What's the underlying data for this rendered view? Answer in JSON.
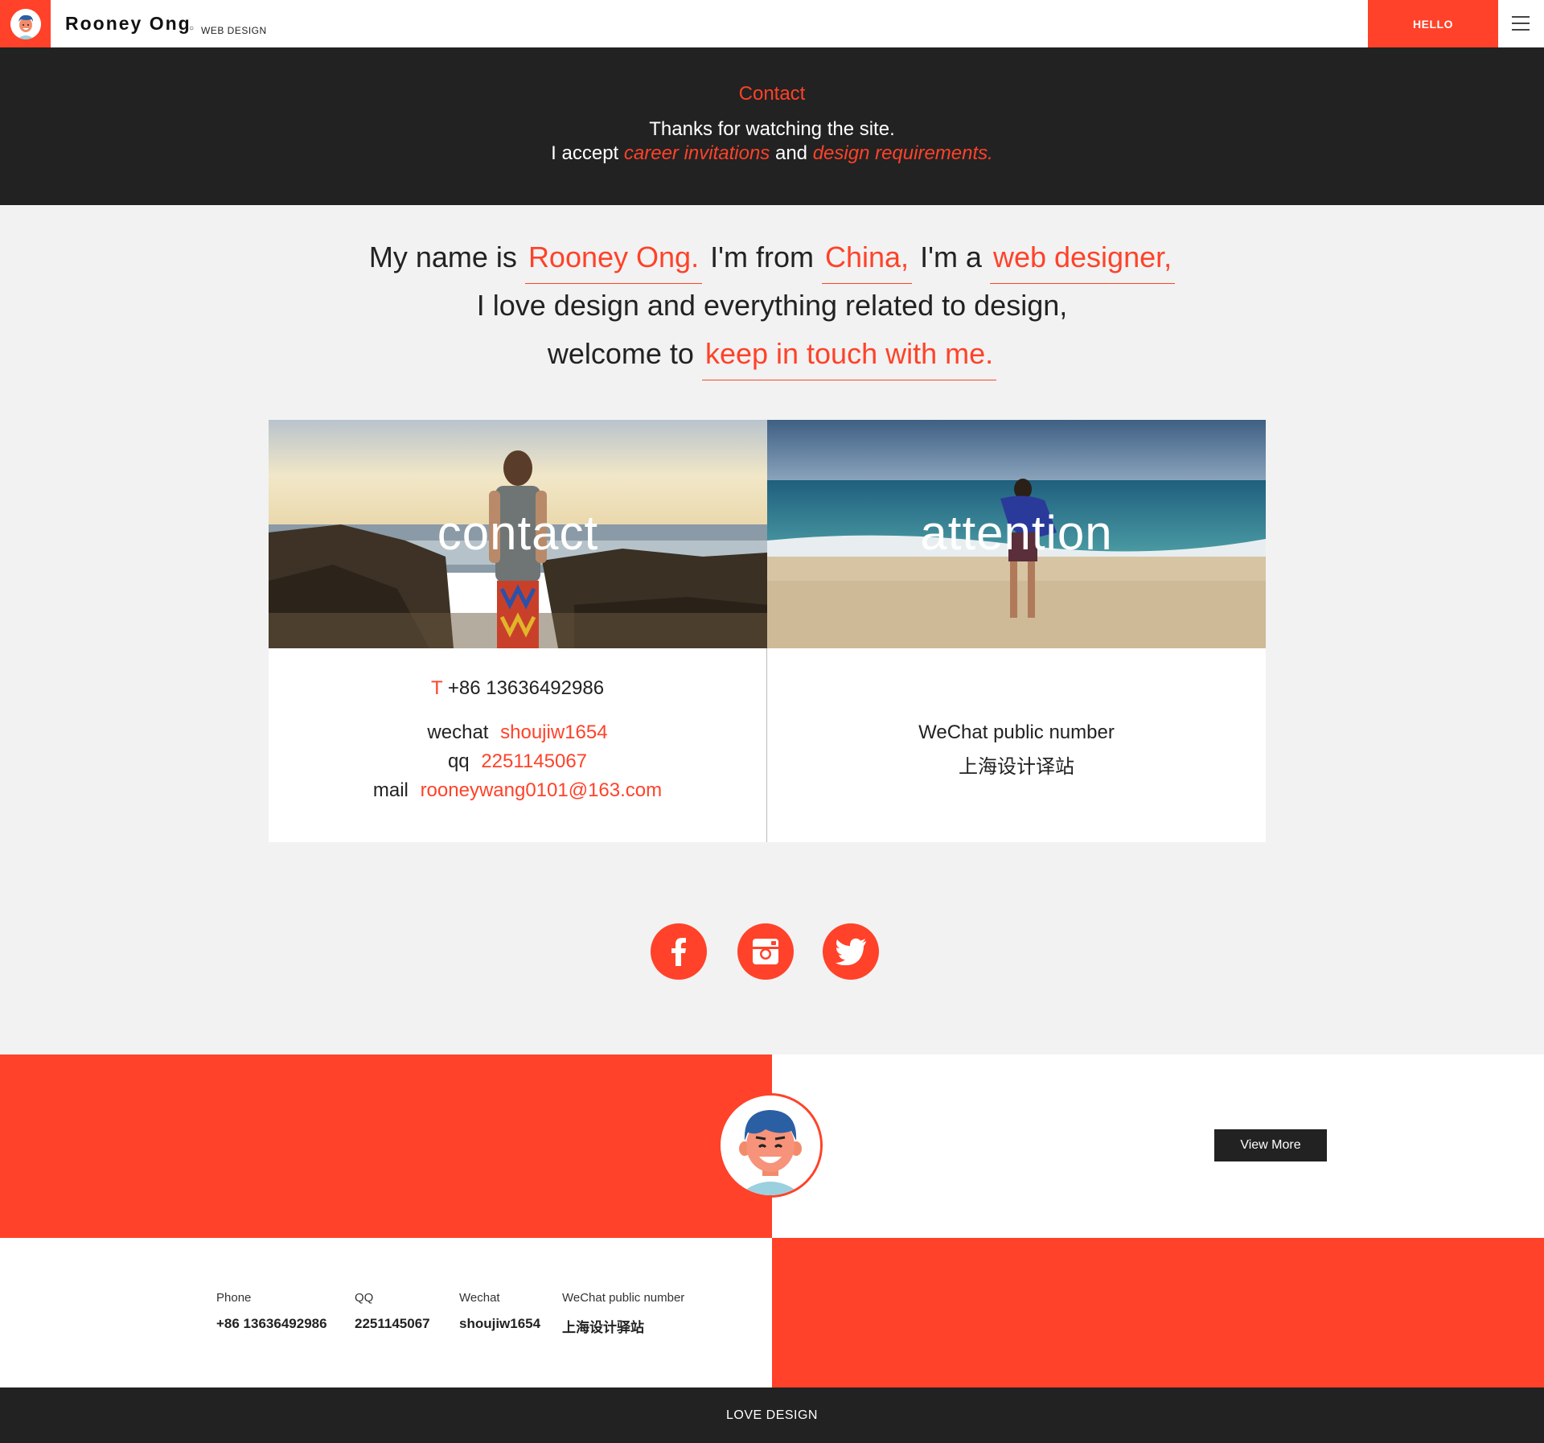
{
  "header": {
    "brand": "Rooney Ong",
    "brand_sub": "WEB DESIGN",
    "hello_label": "HELLO"
  },
  "banner": {
    "title": "Contact",
    "line1": "Thanks for watching the site.",
    "line2_prefix": "I accept",
    "line2_em1": "career invitations",
    "line2_mid": "and",
    "line2_em2": "design requirements."
  },
  "intro": {
    "p1": "My name is",
    "h1": "Rooney Ong.",
    "p2": "I'm from",
    "h2": "China,",
    "p3": "I'm a",
    "h3": "web designer,",
    "line2": "I love design and everything related to design,",
    "p4": "welcome to",
    "h4": "keep in touch with me."
  },
  "cards": {
    "left": {
      "label": "contact",
      "phone_prefix": "T",
      "phone": "+86 13636492986",
      "wechat_label": "wechat",
      "wechat": "shoujiw1654",
      "qq_label": "qq",
      "qq": "2251145067",
      "mail_label": "mail",
      "mail": "rooneywang0101@163.com"
    },
    "right": {
      "label": "attention",
      "line1": "WeChat public number",
      "line2": "上海设计译站"
    }
  },
  "social": [
    "facebook-icon",
    "instagram-icon",
    "twitter-icon"
  ],
  "cta": {
    "view_more": "View More"
  },
  "footer_info": {
    "phone_label": "Phone",
    "phone": "+86 13636492986",
    "qq_label": "QQ",
    "qq": "2251145067",
    "wechat_label": "Wechat",
    "wechat": "shoujiw1654",
    "public_label": "WeChat public number",
    "public": "上海设计驿站"
  },
  "footer": {
    "text": "LOVE DESIGN"
  },
  "colors": {
    "accent": "#ff4229",
    "dark": "#222222",
    "light": "#f2f2f2"
  }
}
